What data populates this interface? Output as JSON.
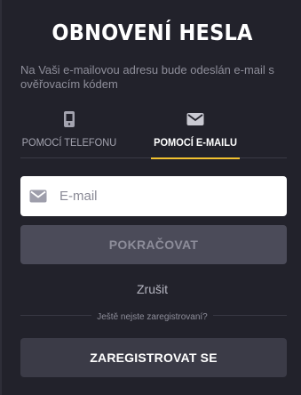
{
  "dialog": {
    "title": "OBNOVENÍ HESLA",
    "subtitle": "Na Vaši e-mailovou adresu bude odeslán e-mail s ověřovacím kódem"
  },
  "tabs": [
    {
      "label": "POMOCÍ TELEFONU",
      "icon": "phone-icon",
      "active": false
    },
    {
      "label": "POMOCÍ E-MAILU",
      "icon": "envelope-icon",
      "active": true
    }
  ],
  "email_input": {
    "placeholder": "E-mail",
    "value": "",
    "icon": "envelope-icon"
  },
  "continue_button": {
    "label": "POKRAČOVAT"
  },
  "cancel_link": {
    "label": "Zrušit"
  },
  "register_prompt": {
    "text": "Ještě nejste zaregistrovaní?"
  },
  "register_button": {
    "label": "ZAREGISTROVAT SE"
  },
  "colors": {
    "background": "#22222b",
    "accent": "#f2c230",
    "button_disabled": "#4b4b59",
    "button_secondary": "#3b3b47"
  }
}
